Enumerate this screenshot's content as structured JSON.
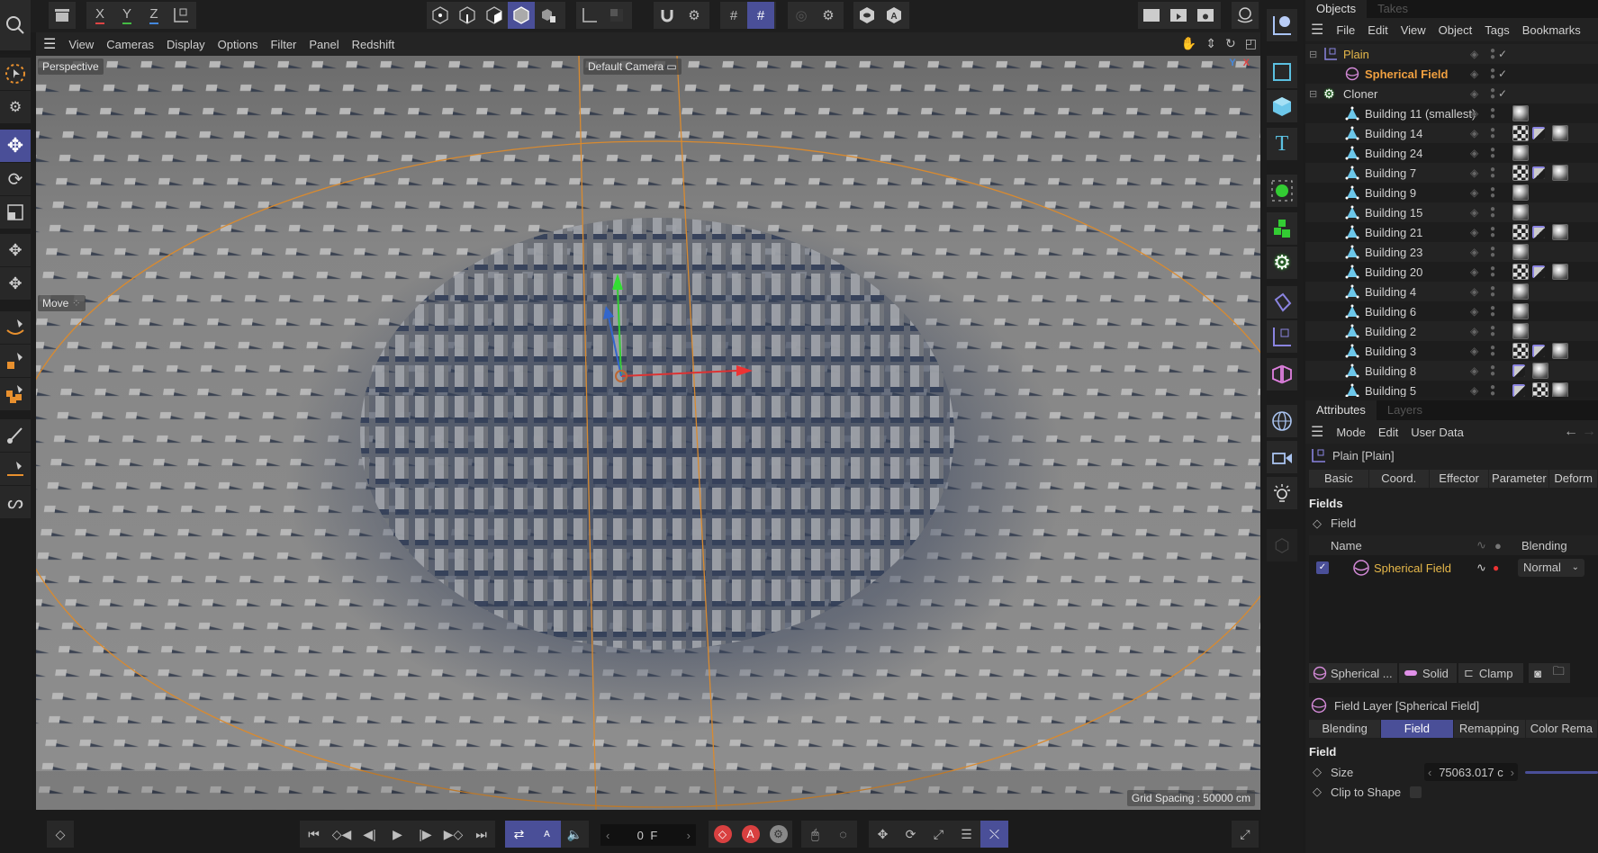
{
  "toolbar": {
    "axis_x": "X",
    "axis_y": "Y",
    "axis_z": "Z",
    "icons_left": [
      "undo-render-icon",
      "x-axis-lock",
      "y-axis-lock",
      "z-axis-lock",
      "coordinate-system-icon"
    ],
    "icons_mode": [
      "points-mode-icon",
      "edges-mode-icon",
      "polygons-mode-icon",
      "model-mode-icon",
      "object-mode-icon"
    ],
    "icons_right": [
      "render-view-icon",
      "render-picture-viewer-icon",
      "render-settings-icon",
      "redshift-ipr-icon"
    ]
  },
  "viewport_menu": [
    "View",
    "Cameras",
    "Display",
    "Options",
    "Filter",
    "Panel",
    "Redshift"
  ],
  "viewport": {
    "projection": "Perspective",
    "camera": "Default Camera",
    "tool_label": "Move",
    "grid_spacing": "Grid Spacing : 50000 cm",
    "axis_labels": {
      "x": "X",
      "y": "Y"
    }
  },
  "objects_panel": {
    "tabs": [
      {
        "label": "Objects",
        "active": true
      },
      {
        "label": "Takes",
        "active": false
      }
    ],
    "menu": [
      "File",
      "Edit",
      "View",
      "Object",
      "Tags",
      "Bookmarks"
    ],
    "items": [
      {
        "name": "Plain",
        "type": "plain",
        "color": "#e6b84a",
        "level": 0,
        "expand": true,
        "check": true,
        "tags": []
      },
      {
        "name": "Spherical Field",
        "type": "field",
        "color": "#f0a040",
        "bold": true,
        "level": 1,
        "check": true,
        "tags": []
      },
      {
        "name": "Cloner",
        "type": "cloner",
        "color": "#d0d0d0",
        "level": 0,
        "expand": true,
        "check": true,
        "tags": []
      },
      {
        "name": "Building 11 (smallest)",
        "type": "poly",
        "level": 1,
        "tags": [
          "material"
        ]
      },
      {
        "name": "Building 14",
        "type": "poly",
        "level": 1,
        "tags": [
          "checker",
          "uvw",
          "material"
        ]
      },
      {
        "name": "Building 24",
        "type": "poly",
        "level": 1,
        "tags": [
          "material"
        ]
      },
      {
        "name": "Building 7",
        "type": "poly",
        "level": 1,
        "tags": [
          "checker",
          "uvw",
          "material"
        ]
      },
      {
        "name": "Building 9",
        "type": "poly",
        "level": 1,
        "tags": [
          "material"
        ]
      },
      {
        "name": "Building 15",
        "type": "poly",
        "level": 1,
        "tags": [
          "material"
        ]
      },
      {
        "name": "Building 21",
        "type": "poly",
        "level": 1,
        "tags": [
          "checker",
          "uvw",
          "material"
        ]
      },
      {
        "name": "Building 23",
        "type": "poly",
        "level": 1,
        "tags": [
          "material"
        ]
      },
      {
        "name": "Building 20",
        "type": "poly",
        "level": 1,
        "tags": [
          "checker",
          "uvw",
          "material"
        ]
      },
      {
        "name": "Building 4",
        "type": "poly",
        "level": 1,
        "tags": [
          "material"
        ]
      },
      {
        "name": "Building 6",
        "type": "poly",
        "level": 1,
        "tags": [
          "material"
        ]
      },
      {
        "name": "Building 2",
        "type": "poly",
        "level": 1,
        "tags": [
          "material"
        ]
      },
      {
        "name": "Building 3",
        "type": "poly",
        "level": 1,
        "tags": [
          "checker",
          "uvw",
          "material"
        ]
      },
      {
        "name": "Building 8",
        "type": "poly",
        "level": 1,
        "tags": [
          "uvw",
          "material"
        ]
      },
      {
        "name": "Building 5",
        "type": "poly",
        "level": 1,
        "tags": [
          "uvw",
          "checker",
          "material"
        ]
      }
    ]
  },
  "attributes_panel": {
    "tabs": [
      {
        "label": "Attributes",
        "active": true
      },
      {
        "label": "Layers",
        "active": false
      }
    ],
    "menu": [
      "Mode",
      "Edit",
      "User Data"
    ],
    "object_title": "Plain [Plain]",
    "object_tabs": [
      "Basic",
      "Coord.",
      "Effector",
      "Parameter",
      "Deform"
    ],
    "section_fields": "Fields",
    "field_label": "Field",
    "list_headers": {
      "name": "Name",
      "blending": "Blending"
    },
    "field_row": {
      "name": "Spherical Field",
      "checked": true,
      "blending": "Normal"
    },
    "layer_toolbar": {
      "field": "Spherical ...",
      "solid": "Solid",
      "clamp": "Clamp"
    },
    "layer_title": "Field Layer [Spherical Field]",
    "layer_tabs": [
      {
        "label": "Blending",
        "active": false
      },
      {
        "label": "Field",
        "active": true
      },
      {
        "label": "Remapping",
        "active": false
      },
      {
        "label": "Color Rema",
        "active": false
      }
    ],
    "section_field": "Field",
    "size_label": "Size",
    "size_value": "75063.017 c",
    "clip_label": "Clip to Shape",
    "clip_checked": false
  },
  "timeline": {
    "frame": "0 F"
  },
  "colors": {
    "accent": "#4a4f98",
    "field_orange": "#f0a040",
    "plain_yellow": "#e6b84a",
    "record_red": "#d94040"
  }
}
